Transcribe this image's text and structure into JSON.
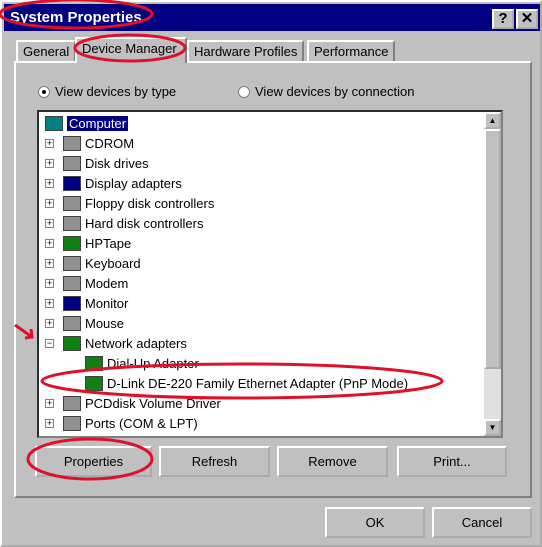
{
  "window": {
    "title": "System Properties",
    "help": "?",
    "close": "✕"
  },
  "tabs": [
    {
      "label": "General"
    },
    {
      "label": "Device Manager",
      "active": true
    },
    {
      "label": "Hardware Profiles"
    },
    {
      "label": "Performance"
    }
  ],
  "view_options": [
    {
      "label": "View devices by type",
      "selected": true
    },
    {
      "label": "View devices by connection",
      "selected": false
    }
  ],
  "tree": [
    {
      "label": "Computer",
      "level": 0,
      "icon": "computer-icon",
      "selected": true
    },
    {
      "label": "CDROM",
      "level": 1,
      "expander": "+",
      "icon": "cdrom-icon"
    },
    {
      "label": "Disk drives",
      "level": 1,
      "expander": "+",
      "icon": "disk-icon"
    },
    {
      "label": "Display adapters",
      "level": 1,
      "expander": "+",
      "icon": "monitor-icon"
    },
    {
      "label": "Floppy disk controllers",
      "level": 1,
      "expander": "+",
      "icon": "controller-icon"
    },
    {
      "label": "Hard disk controllers",
      "level": 1,
      "expander": "+",
      "icon": "controller-icon"
    },
    {
      "label": "HPTape",
      "level": 1,
      "expander": "+",
      "icon": "board-icon"
    },
    {
      "label": "Keyboard",
      "level": 1,
      "expander": "+",
      "icon": "keyboard-icon"
    },
    {
      "label": "Modem",
      "level": 1,
      "expander": "+",
      "icon": "modem-icon"
    },
    {
      "label": "Monitor",
      "level": 1,
      "expander": "+",
      "icon": "monitor-icon"
    },
    {
      "label": "Mouse",
      "level": 1,
      "expander": "+",
      "icon": "mouse-icon"
    },
    {
      "label": "Network adapters",
      "level": 1,
      "expander": "-",
      "icon": "network-card-icon"
    },
    {
      "label": "Dial-Up Adapter",
      "level": 2,
      "icon": "network-card-icon"
    },
    {
      "label": "D-Link DE-220 Family Ethernet Adapter (PnP Mode)",
      "level": 2,
      "icon": "network-card-icon"
    },
    {
      "label": "PCDdisk Volume Driver",
      "level": 1,
      "expander": "+",
      "icon": "disk-icon"
    },
    {
      "label": "Ports (COM & LPT)",
      "level": 1,
      "expander": "+",
      "icon": "port-icon"
    }
  ],
  "buttons": {
    "properties": "Properties",
    "refresh": "Refresh",
    "remove": "Remove",
    "print": "Print...",
    "ok": "OK",
    "cancel": "Cancel"
  },
  "colors": {
    "titlebar": "#000080",
    "annotation": "#e0102a"
  }
}
